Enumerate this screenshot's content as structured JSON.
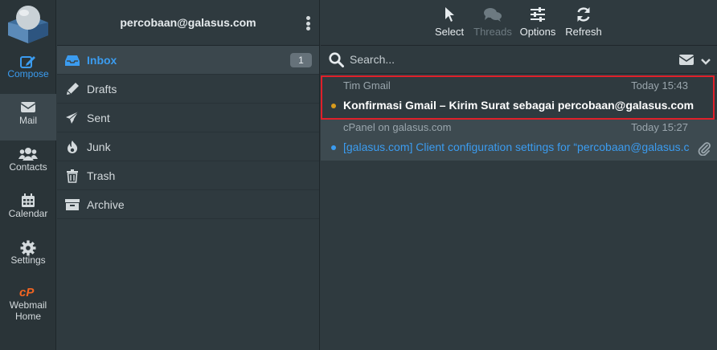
{
  "nav": {
    "compose": "Compose",
    "mail": "Mail",
    "contacts": "Contacts",
    "calendar": "Calendar",
    "settings": "Settings",
    "webmail_home_1": "Webmail",
    "webmail_home_2": "Home"
  },
  "account": {
    "email": "percobaan@galasus.com"
  },
  "folders": [
    {
      "label": "Inbox",
      "icon": "inbox-icon",
      "count": "1",
      "active": true
    },
    {
      "label": "Drafts",
      "icon": "pencil-icon"
    },
    {
      "label": "Sent",
      "icon": "paper-plane-icon"
    },
    {
      "label": "Junk",
      "icon": "fire-icon"
    },
    {
      "label": "Trash",
      "icon": "trash-icon"
    },
    {
      "label": "Archive",
      "icon": "archive-icon"
    }
  ],
  "toolbar": {
    "select": "Select",
    "threads": "Threads",
    "options": "Options",
    "refresh": "Refresh"
  },
  "search": {
    "placeholder": "Search..."
  },
  "messages": [
    {
      "from": "Tim Gmail",
      "date": "Today 15:43",
      "subject": "Konfirmasi Gmail – Kirim Surat sebagai percobaan@galasus.com",
      "unread": true,
      "highlighted": true
    },
    {
      "from": "cPanel on galasus.com",
      "date": "Today 15:27",
      "subject": "[galasus.com] Client configuration settings for “percobaan@galasus.com”",
      "selected": true,
      "attachment": true
    }
  ],
  "colors": {
    "accent": "#3b9cf0",
    "highlight_border": "#e0202a",
    "unread_dot": "#d89b1c",
    "cpanel_orange": "#f26522"
  }
}
